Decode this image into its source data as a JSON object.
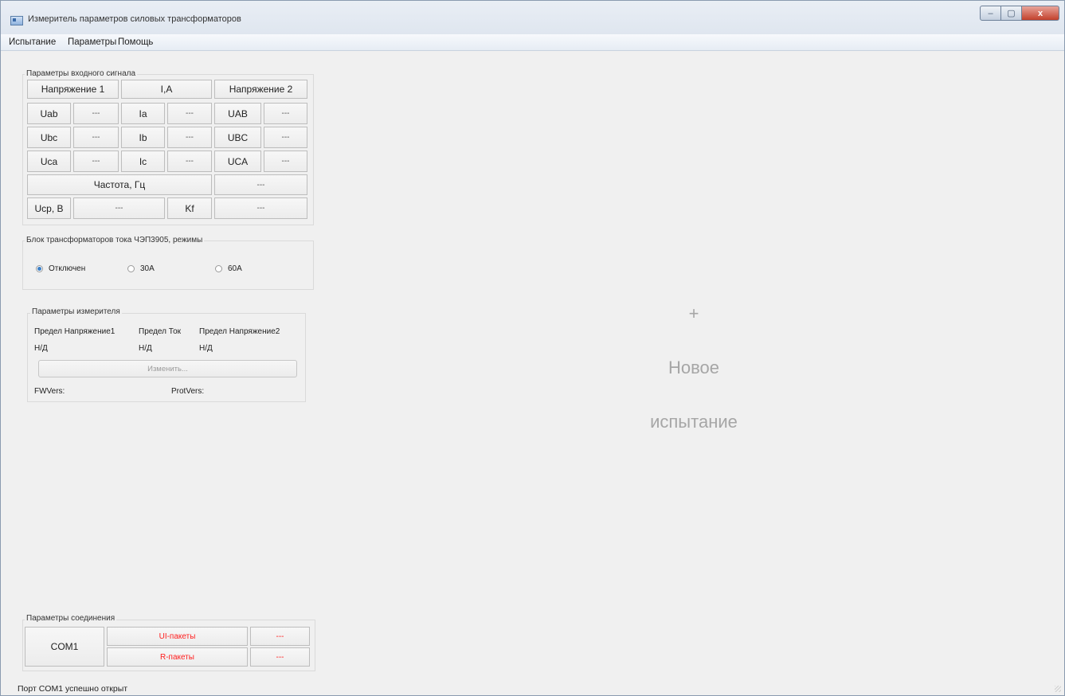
{
  "window": {
    "title": "Измеритель параметров силовых трансформаторов",
    "controls": {
      "minimize": "–",
      "maximize": "▢",
      "close": "x"
    }
  },
  "menu": [
    "Испытание",
    "Параметры",
    "Помощь"
  ],
  "input_signal": {
    "title": "Параметры входного сигнала",
    "headers": [
      "Напряжение 1",
      "I,A",
      "Напряжение 2"
    ],
    "rows": [
      {
        "u1": "Uab",
        "u1v": "---",
        "i": "Ia",
        "iv": "---",
        "u2": "UAB",
        "u2v": "---"
      },
      {
        "u1": "Ubc",
        "u1v": "---",
        "i": "Ib",
        "iv": "---",
        "u2": "UBC",
        "u2v": "---"
      },
      {
        "u1": "Uca",
        "u1v": "---",
        "i": "Ic",
        "iv": "---",
        "u2": "UCA",
        "u2v": "---"
      }
    ],
    "freq_label": "Частота, Гц",
    "freq_value": "---",
    "ucp_label": "Ucp, B",
    "ucp_value": "---",
    "kf_label": "Kf",
    "kf_value": "---"
  },
  "ct_block": {
    "title": "Блок трансформаторов тока ЧЭП3905, режимы",
    "options": [
      "Отключен",
      "30A",
      "60A"
    ],
    "selected": "Отключен"
  },
  "meter_params": {
    "title": "Параметры измерителя",
    "col_labels": [
      "Предел Напряжение1",
      "Предел Ток",
      "Предел Напряжение2"
    ],
    "col_values": [
      "Н/Д",
      "Н/Д",
      "Н/Д"
    ],
    "change_button": "Изменить...",
    "fw_label": "FWVers:",
    "prot_label": "ProtVers:"
  },
  "new_test": {
    "plus": "+",
    "line1": "Новое",
    "line2": "испытание"
  },
  "connection": {
    "title": "Параметры соединения",
    "port": "COM1",
    "ui_packets_label": "UI-пакеты",
    "ui_packets_value": "---",
    "r_packets_label": "R-пакеты",
    "r_packets_value": "---"
  },
  "status_bar": "Порт COM1 успешно открыт"
}
